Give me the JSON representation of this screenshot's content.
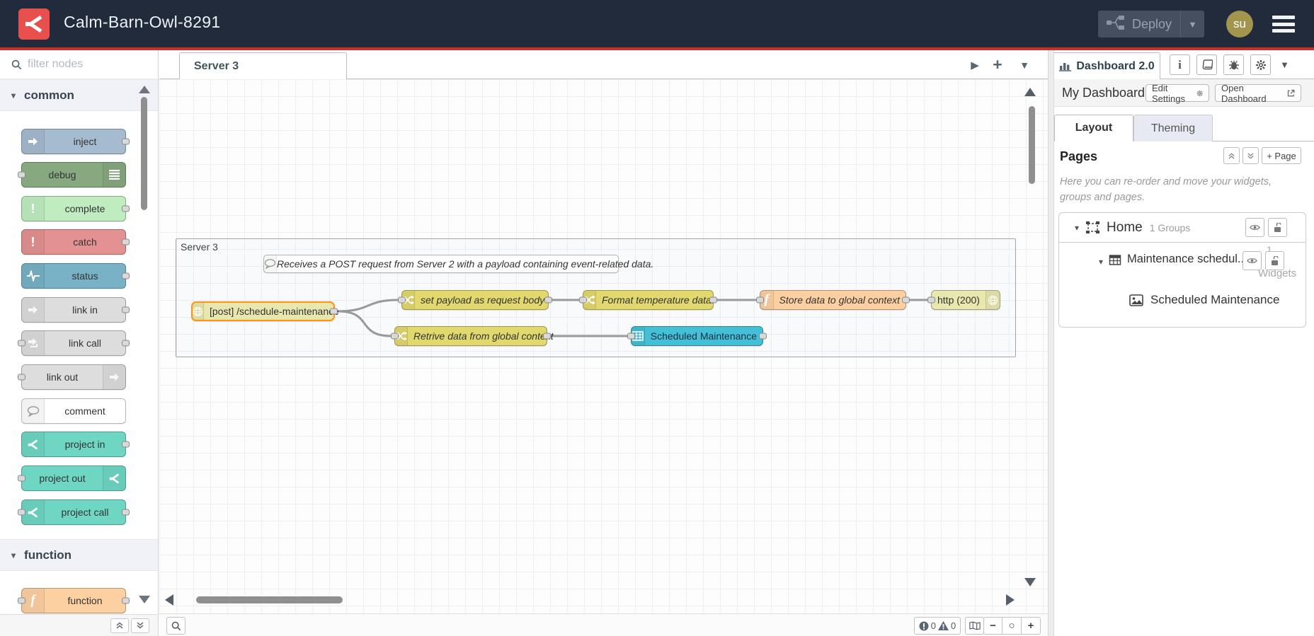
{
  "header": {
    "title": "Calm-Barn-Owl-8291",
    "deploy_label": "Deploy",
    "avatar_text": "su"
  },
  "palette": {
    "filter_placeholder": "filter nodes",
    "sections": [
      {
        "label": "common",
        "nodes": [
          {
            "label": "inject",
            "color": "#a6bbcf"
          },
          {
            "label": "debug",
            "color": "#87a980"
          },
          {
            "label": "complete",
            "color": "#c0edc0"
          },
          {
            "label": "catch",
            "color": "#e49191"
          },
          {
            "label": "status",
            "color": "#79b2c7"
          },
          {
            "label": "link in",
            "color": "#dddddd"
          },
          {
            "label": "link call",
            "color": "#dddddd"
          },
          {
            "label": "link out",
            "color": "#dddddd"
          },
          {
            "label": "comment",
            "color": "#ffffff"
          },
          {
            "label": "project in",
            "color": "#6fd6c4"
          },
          {
            "label": "project out",
            "color": "#6fd6c4"
          },
          {
            "label": "project call",
            "color": "#6fd6c4"
          }
        ]
      },
      {
        "label": "function",
        "nodes": [
          {
            "label": "function",
            "color": "#fdd0a2"
          }
        ]
      }
    ]
  },
  "workspace": {
    "active_tab": "Server 3",
    "tab_add": "+",
    "group_label": "Server 3",
    "comment_text": "Receives a POST request from Server 2 with a payload containing event-related data.",
    "flow_nodes": [
      {
        "label": "[post] /schedule-maintenance",
        "type": "http in",
        "color": "#e7e7ae",
        "selected": true
      },
      {
        "label": "set payload as request body",
        "type": "change",
        "color": "#e2d96e"
      },
      {
        "label": "Format temperature data.",
        "type": "change",
        "color": "#e2d96e"
      },
      {
        "label": "Store data to global context",
        "type": "function",
        "color": "#fdd0a2"
      },
      {
        "label": "http (200)",
        "type": "http response",
        "color": "#e7e7ae"
      },
      {
        "label": "Retrive data from global context",
        "type": "change",
        "color": "#e2d96e"
      },
      {
        "label": "Scheduled Maintenance",
        "type": "ui-table",
        "color": "#43bfd7"
      }
    ],
    "footer": {
      "error_count": "0",
      "warning_count": "0",
      "zoom_out": "−",
      "zoom_reset": "○",
      "zoom_in": "+"
    }
  },
  "sidebar": {
    "tab_label": "Dashboard 2.0",
    "dashboard_name": "My Dashboard",
    "edit_settings_label": "Edit Settings",
    "open_dashboard_label": "Open Dashboard",
    "tabs": [
      {
        "label": "Layout"
      },
      {
        "label": "Theming"
      }
    ],
    "pages_title": "Pages",
    "add_page_label": "+ Page",
    "help_text": "Here you can re-order and move your widgets, groups and pages.",
    "tree": {
      "page_label": "Home",
      "page_meta": "1 Groups",
      "group_label": "Maintenance schedul...",
      "group_meta_count": "1",
      "group_meta_word": "Widgets",
      "widget_label": "Scheduled Maintenance"
    }
  },
  "colors": {
    "header_bg": "#212b3c",
    "accent_red": "#c9302c",
    "logo_red": "#e8504e",
    "avatar_olive": "#a2964e",
    "selected_node_border": "#ff9314",
    "wire": "#999999"
  }
}
